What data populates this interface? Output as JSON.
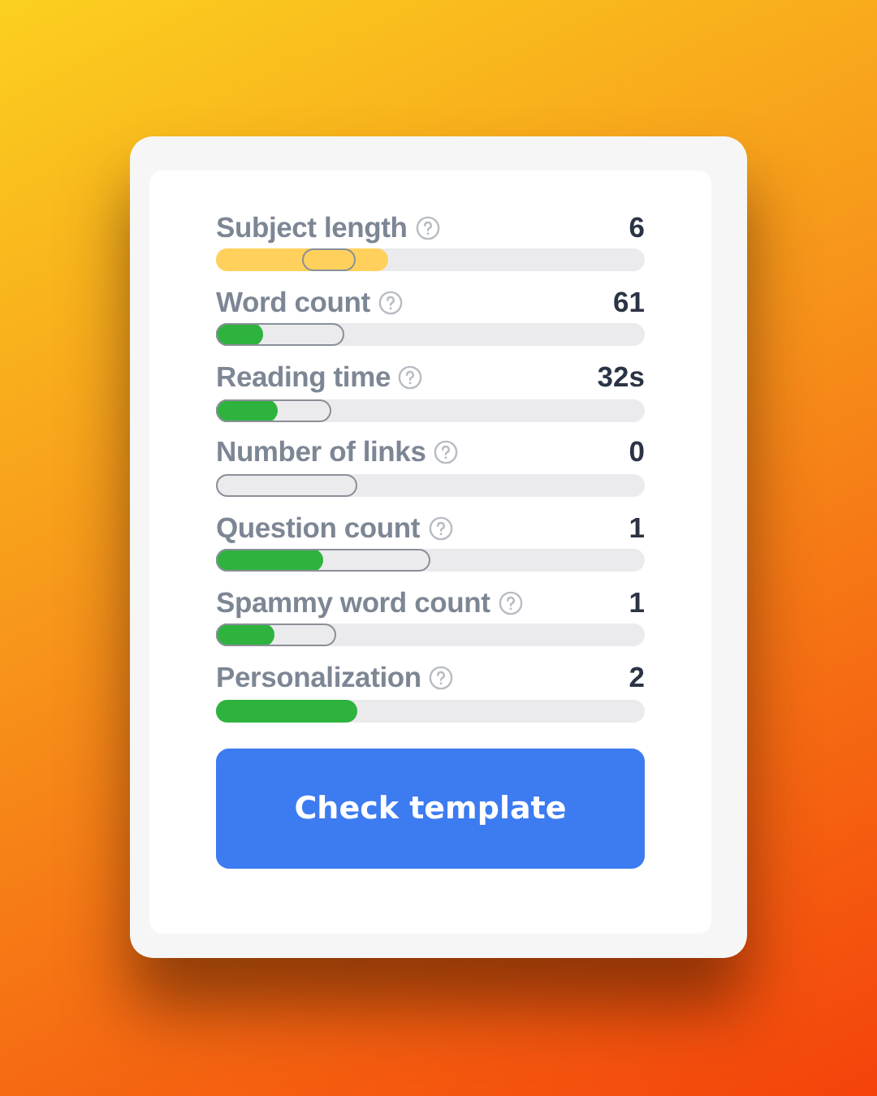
{
  "metrics": [
    {
      "label": "Subject length",
      "value": "6",
      "color": "#ffd15c",
      "level": 0.4,
      "thumb": {
        "level": 0.265
      }
    },
    {
      "label": "Word count",
      "value": "61",
      "color": "#2eb33e",
      "level": 0.11,
      "ideal": {
        "level": 0.3
      }
    },
    {
      "label": "Reading time",
      "value": "32s",
      "color": "#2eb33e",
      "level": 0.145,
      "ideal": {
        "level": 0.27
      }
    },
    {
      "label": "Number of links",
      "value": "0",
      "ideal": {
        "level": 0.33
      }
    },
    {
      "label": "Question count",
      "value": "1",
      "color": "#2eb33e",
      "level": 0.25,
      "ideal": {
        "level": 0.5
      }
    },
    {
      "label": "Spammy word count",
      "value": "1",
      "color": "#2eb33e",
      "level": 0.135,
      "ideal": {
        "level": 0.28
      }
    },
    {
      "label": "Personalization",
      "value": "2",
      "color": "#2eb33e",
      "level": 0.33
    }
  ],
  "button": {
    "label": "Check template"
  }
}
